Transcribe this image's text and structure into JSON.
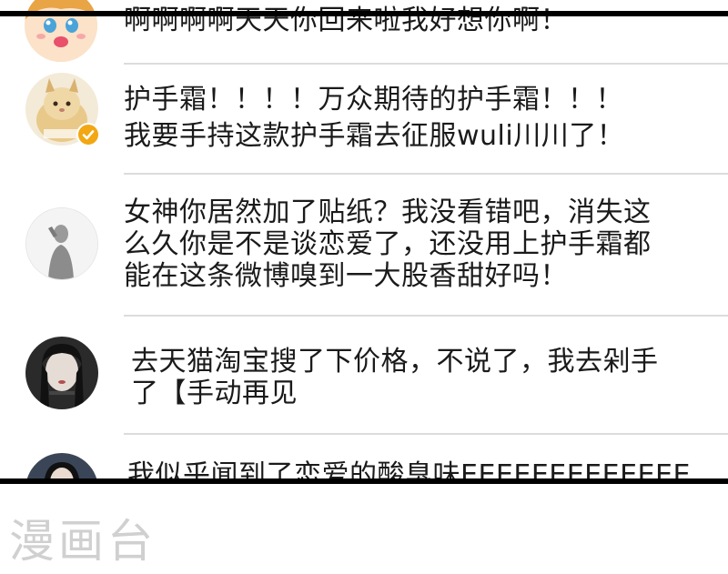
{
  "comments": [
    {
      "text": "啊啊啊啊天天你回来啦我好想你啊！"
    },
    {
      "line1": "护手霜！！！！万众期待的护手霜！！！",
      "line2": "我要手持这款护手霜去征服wuli川川了！",
      "verified": true
    },
    {
      "line1": "女神你居然加了贴纸？我没看错吧，消失这",
      "line2": "么久你是不是谈恋爱了，还没用上护手霜都",
      "line3": "能在这条微博嗅到一大股香甜好吗！"
    },
    {
      "line1": "去天猫淘宝搜了下价格，不说了，我去剁手",
      "line2": "了【手动再见"
    },
    {
      "text": "我似乎闻到了恋爱的酸臭味EEEEEEEEEEEEE"
    }
  ],
  "watermark": "漫画台",
  "colors": {
    "verified_badge": "#f2a713",
    "divider": "#dcdcdc",
    "text": "#1a1a1a",
    "watermark": "#d0d0d0"
  }
}
